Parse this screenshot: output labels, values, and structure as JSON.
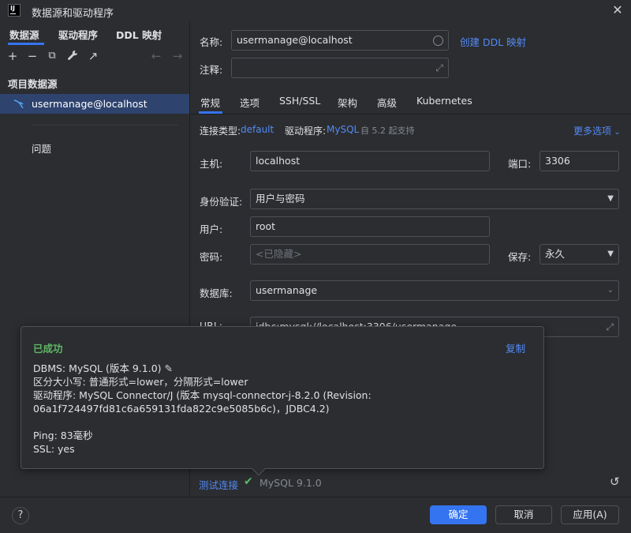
{
  "window": {
    "title": "数据源和驱动程序"
  },
  "left_tabs": [
    "数据源",
    "驱动程序",
    "DDL 映射"
  ],
  "toolbar": {
    "add": "+",
    "remove": "−",
    "copy": "⧉",
    "wrench": "🔧",
    "jump": "↗",
    "back": "←",
    "forward": "→"
  },
  "sidebar": {
    "section_title": "项目数据源",
    "datasource": "usermanage@localhost",
    "problems": "问题"
  },
  "form": {
    "name_label": "名称:",
    "name_value": "usermanage@localhost",
    "create_ddl": "创建 DDL 映射",
    "comment_label": "注释:",
    "comment_value": "",
    "tabs": [
      "常规",
      "选项",
      "SSH/SSL",
      "架构",
      "高级",
      "Kubernetes"
    ],
    "conn_type_label": "连接类型:",
    "conn_type_value": "default",
    "driver_label": "驱动程序:",
    "driver_value": "MySQL",
    "driver_note": "自 5.2 起支持",
    "more_options": "更多选项",
    "host_label": "主机:",
    "host_value": "localhost",
    "port_label": "端口:",
    "port_value": "3306",
    "auth_label": "身份验证:",
    "auth_value": "用户与密码",
    "user_label": "用户:",
    "user_value": "root",
    "password_label": "密码:",
    "password_placeholder": "<已隐藏>",
    "save_label": "保存:",
    "save_value": "永久",
    "database_label": "数据库:",
    "database_value": "usermanage",
    "url_label": "URL:",
    "url_value": "jdbc:mysql://localhost:3306/usermanage"
  },
  "popup": {
    "status": "已成功",
    "copy": "复制",
    "dbms": "DBMS: MySQL (版本 9.1.0)",
    "case": "区分大小写: 普通形式=lower，分隔形式=lower",
    "driver_line1": "驱动程序: MySQL Connector/J (版本 mysql-connector-j-8.2.0 (Revision:",
    "driver_line2": "06a1f724497fd81c6a659131fda822c9e5085b6c)，JDBC4.2)",
    "ping": "Ping: 83毫秒",
    "ssl": "SSL: yes"
  },
  "test": {
    "link": "测试连接",
    "result": "MySQL 9.1.0"
  },
  "buttons": {
    "help": "?",
    "ok": "确定",
    "cancel": "取消",
    "apply": "应用(A)"
  },
  "colors": {
    "accent": "#3574f0",
    "link": "#548af7",
    "success": "#5fb865"
  }
}
